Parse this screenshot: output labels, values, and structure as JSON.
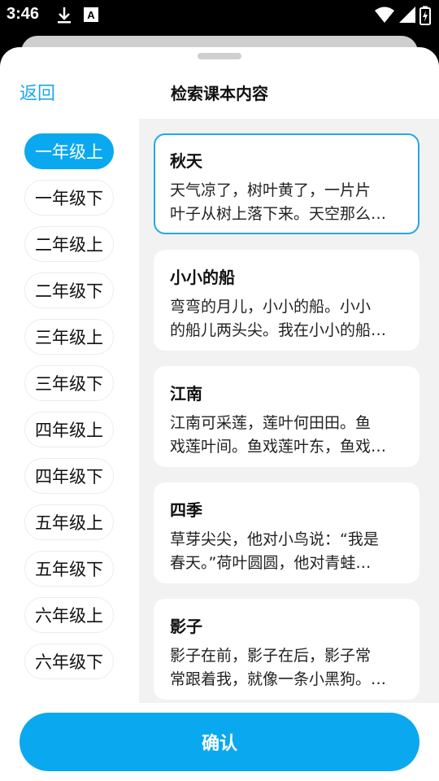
{
  "status_bar": {
    "time": "3:46",
    "icons": [
      "download-icon",
      "keyboard-a-icon",
      "wifi-icon",
      "signal-icon",
      "battery-charging-icon"
    ]
  },
  "header": {
    "back_label": "返回",
    "title": "检索课本内容"
  },
  "grades": [
    {
      "label": "一年级上",
      "selected": true
    },
    {
      "label": "一年级下",
      "selected": false
    },
    {
      "label": "二年级上",
      "selected": false
    },
    {
      "label": "二年级下",
      "selected": false
    },
    {
      "label": "三年级上",
      "selected": false
    },
    {
      "label": "三年级下",
      "selected": false
    },
    {
      "label": "四年级上",
      "selected": false
    },
    {
      "label": "四年级下",
      "selected": false
    },
    {
      "label": "五年级上",
      "selected": false
    },
    {
      "label": "五年级下",
      "selected": false
    },
    {
      "label": "六年级上",
      "selected": false
    },
    {
      "label": "六年级下",
      "selected": false
    }
  ],
  "lessons": [
    {
      "title": "秋天",
      "line1": "天气凉了，树叶黄了，一片片",
      "line2": "叶子从树上落下来。天空那么…",
      "selected": true
    },
    {
      "title": "小小的船",
      "line1": "弯弯的月儿，小小的船。小小",
      "line2": "的船儿两头尖。我在小小的船…",
      "selected": false
    },
    {
      "title": "江南",
      "line1": "江南可采莲，莲叶何田田。鱼",
      "line2": "戏莲叶间。鱼戏莲叶东，鱼戏…",
      "selected": false
    },
    {
      "title": "四季",
      "line1": "草芽尖尖，他对小鸟说：“我是",
      "line2": "春天。”荷叶圆圆，他对青蛙…",
      "selected": false
    },
    {
      "title": "影子",
      "line1": "影子在前，影子在后，影子常",
      "line2": "常跟着我，就像一条小黑狗。…",
      "selected": false
    }
  ],
  "confirm_label": "确认",
  "colors": {
    "accent": "#0aa9ef",
    "link": "#1ea7e6",
    "panel_bg": "#f2f2f2"
  }
}
